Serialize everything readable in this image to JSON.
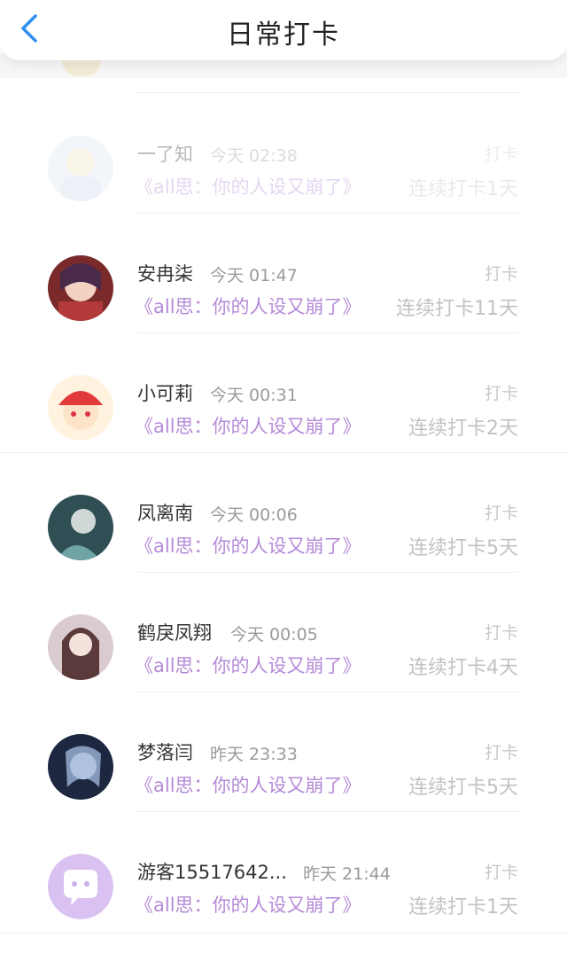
{
  "header": {
    "title": "日常打卡"
  },
  "rows": [
    {
      "name": "一了知",
      "time": "今天 02:38",
      "action": "打卡",
      "book": "《all思：你的人设又崩了》",
      "streak": "连续打卡1天",
      "avatar": "avatar-icon"
    },
    {
      "name": "安冉柒",
      "time": "今天 01:47",
      "action": "打卡",
      "book": "《all思：你的人设又崩了》",
      "streak": "连续打卡11天",
      "avatar": "avatar-icon"
    },
    {
      "name": "小可莉",
      "time": "今天 00:31",
      "action": "打卡",
      "book": "《all思：你的人设又崩了》",
      "streak": "连续打卡2天",
      "avatar": "avatar-icon"
    },
    {
      "name": "凤离南",
      "time": "今天 00:06",
      "action": "打卡",
      "book": "《all思：你的人设又崩了》",
      "streak": "连续打卡5天",
      "avatar": "avatar-icon"
    },
    {
      "name": "鹤戾凤翔",
      "time": "今天 00:05",
      "action": "打卡",
      "book": "《all思：你的人设又崩了》",
      "streak": "连续打卡4天",
      "avatar": "avatar-icon"
    },
    {
      "name": "梦落闫",
      "time": "昨天 23:33",
      "action": "打卡",
      "book": "《all思：你的人设又崩了》",
      "streak": "连续打卡5天",
      "avatar": "avatar-icon"
    },
    {
      "name": "游客15517642...",
      "time": "昨天 21:44",
      "action": "打卡",
      "book": "《all思：你的人设又崩了》",
      "streak": "连续打卡1天",
      "avatar": "chat-bubble-icon"
    }
  ],
  "colors": {
    "accent": "#2e8ff0",
    "book": "#b48ad8",
    "guest_avatar": "#d9c2f2"
  }
}
